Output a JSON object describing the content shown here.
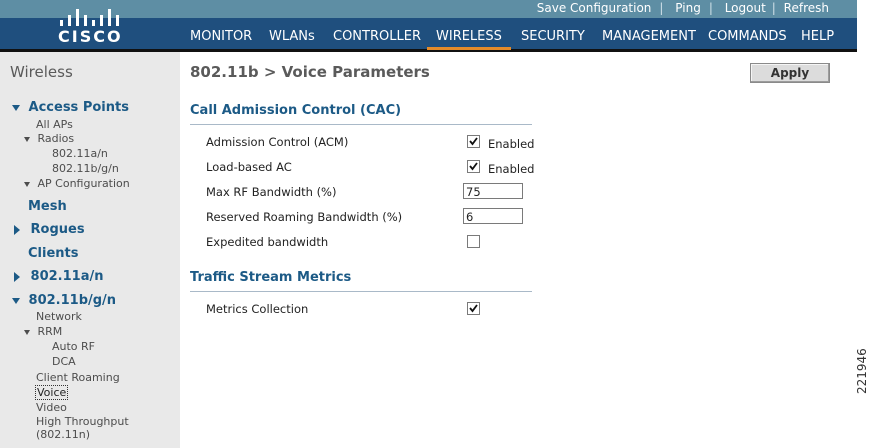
{
  "topbar": {
    "links": [
      "Save Configuration",
      "Ping",
      "Logout",
      "Refresh"
    ]
  },
  "header": {
    "logo_text": "CISCO",
    "nav": [
      "MONITOR",
      "WLANs",
      "CONTROLLER",
      "WIRELESS",
      "SECURITY",
      "MANAGEMENT",
      "COMMANDS",
      "HELP"
    ],
    "active_tab": "WIRELESS"
  },
  "sidebar": {
    "title": "Wireless",
    "access_points": "Access Points",
    "all_aps": "All APs",
    "radios": "Radios",
    "radio_a": "802.11a/n",
    "radio_bg": "802.11b/g/n",
    "ap_config": "AP Configuration",
    "mesh": "Mesh",
    "rogues": "Rogues",
    "clients": "Clients",
    "band_a": "802.11a/n",
    "band_bg": "802.11b/g/n",
    "network": "Network",
    "rrm": "RRM",
    "auto_rf": "Auto RF",
    "dca": "DCA",
    "client_roaming": "Client Roaming",
    "voice": "Voice",
    "video": "Video",
    "high_throughput": "High Throughput",
    "high_throughput_sub": "(802.11n)"
  },
  "main": {
    "title": "802.11b > Voice Parameters",
    "apply_label": "Apply",
    "cac": {
      "heading": "Call Admission Control (CAC)",
      "acm_label": "Admission Control (ACM)",
      "acm_checked": true,
      "acm_text": "Enabled",
      "lbac_label": "Load-based AC",
      "lbac_checked": true,
      "lbac_text": "Enabled",
      "max_rf_label": "Max RF Bandwidth (%)",
      "max_rf_value": "75",
      "roaming_label": "Reserved Roaming Bandwidth (%)",
      "roaming_value": "6",
      "expedited_label": "Expedited bandwidth",
      "expedited_checked": false
    },
    "tsm": {
      "heading": "Traffic Stream Metrics",
      "metrics_label": "Metrics Collection",
      "metrics_checked": true
    }
  },
  "figure_number": "221946",
  "colors": {
    "topbar": "#5e8ea4",
    "header": "#1f4f7e",
    "accent": "#e58b2a",
    "sidebar": "#e9e9e9",
    "link": "#1c5a86"
  }
}
